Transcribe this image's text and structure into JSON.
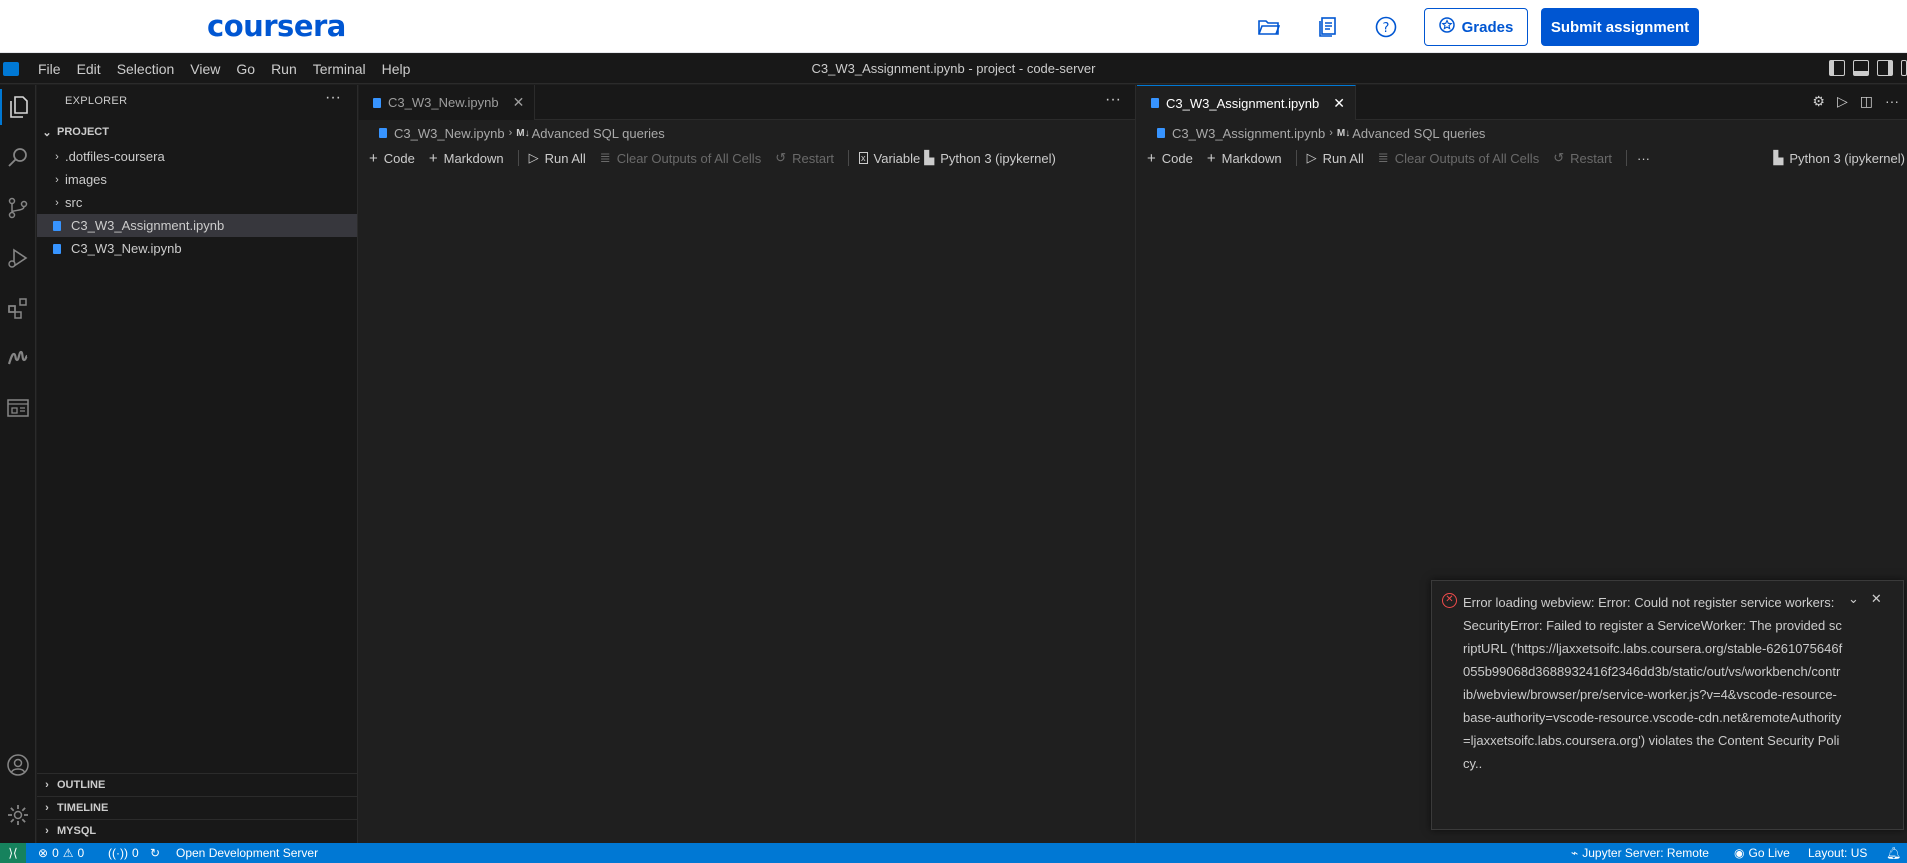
{
  "coursera": {
    "logo": "coursera",
    "grades_label": "Grades",
    "submit_label": "Submit assignment"
  },
  "titlebar": {
    "menu": [
      "File",
      "Edit",
      "Selection",
      "View",
      "Go",
      "Run",
      "Terminal",
      "Help"
    ],
    "window_title": "C3_W3_Assignment.ipynb - project - code-server"
  },
  "sidebar": {
    "title": "EXPLORER",
    "project": "PROJECT",
    "folders": [
      ".dotfiles-coursera",
      "images",
      "src"
    ],
    "files": [
      "C3_W3_Assignment.ipynb",
      "C3_W3_New.ipynb"
    ],
    "panes": [
      "OUTLINE",
      "TIMELINE",
      "MYSQL"
    ]
  },
  "left_editor": {
    "tab": "C3_W3_New.ipynb",
    "breadcrumb_file": "C3_W3_New.ipynb",
    "breadcrumb_md": "M↓",
    "breadcrumb_section": "Advanced SQL queries",
    "toolbar": {
      "code": "Code",
      "markdown": "Markdown",
      "run_all": "Run All",
      "clear": "Clear Outputs of All Cells",
      "restart": "Restart",
      "variables": "Variable",
      "kernel": "Python 3 (ipykernel)"
    }
  },
  "right_editor": {
    "tab": "C3_W3_Assignment.ipynb",
    "breadcrumb_file": "C3_W3_Assignment.ipynb",
    "breadcrumb_md": "M↓",
    "breadcrumb_section": "Advanced SQL queries",
    "toolbar": {
      "code": "Code",
      "markdown": "Markdown",
      "run_all": "Run All",
      "clear": "Clear Outputs of All Cells",
      "restart": "Restart",
      "kernel": "Python 3 (ipykernel)"
    }
  },
  "notification": {
    "message": "Error loading webview: Error: Could not register service workers: SecurityError: Failed to register a ServiceWorker: The provided scriptURL ('https://ljaxxetsoifc.labs.coursera.org/stable-6261075646f055b99068d3688932416f2346dd3b/static/out/vs/workbench/contrib/webview/browser/pre/service-worker.js?v=4&vscode-resource-base-authority=vscode-resource.vscode-cdn.net&remoteAuthority=ljaxxetsoifc.labs.coursera.org') violates the Content Security Policy.."
  },
  "statusbar": {
    "errors": "0",
    "warnings": "0",
    "ports": "0",
    "open_dev_server": "Open Development Server",
    "jupyter": "Jupyter Server: Remote",
    "go_live": "Go Live",
    "layout": "Layout: US"
  }
}
